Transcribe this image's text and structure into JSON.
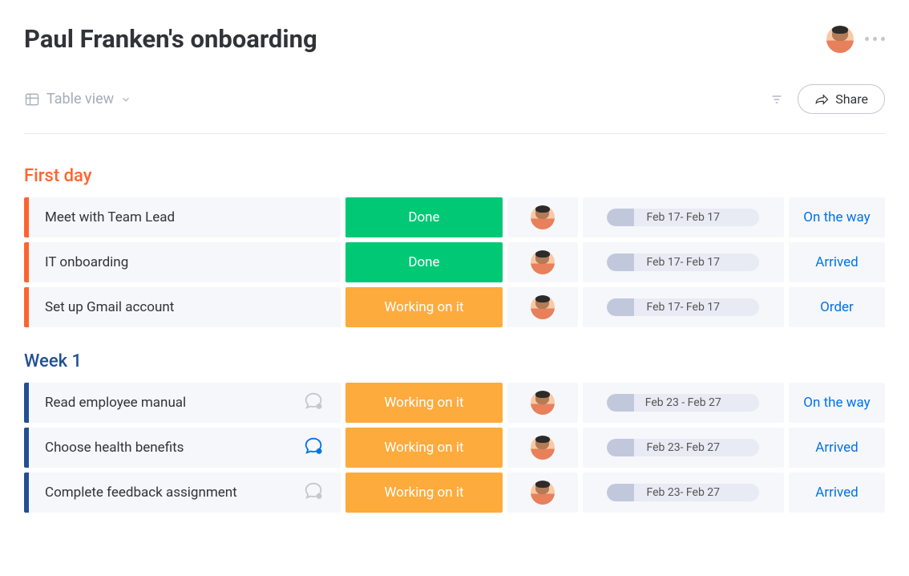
{
  "header": {
    "title": "Paul Franken's onboarding"
  },
  "toolbar": {
    "view_label": "Table view",
    "share_label": "Share"
  },
  "groups": [
    {
      "id": "first-day",
      "title": "First day",
      "color": "orange",
      "rows": [
        {
          "task": "Meet with Team Lead",
          "chat": "none",
          "status": "Done",
          "status_class": "done",
          "date": "Feb 17- Feb 17",
          "fill": 18,
          "action": "On the way"
        },
        {
          "task": "IT onboarding",
          "chat": "none",
          "status": "Done",
          "status_class": "done",
          "date": "Feb 17- Feb 17",
          "fill": 18,
          "action": "Arrived"
        },
        {
          "task": "Set up Gmail account",
          "chat": "none",
          "status": "Working on it",
          "status_class": "working",
          "date": "Feb 17- Feb 17",
          "fill": 18,
          "action": "Order"
        }
      ]
    },
    {
      "id": "week-1",
      "title": "Week 1",
      "color": "navy",
      "rows": [
        {
          "task": "Read employee manual",
          "chat": "empty",
          "status": "Working on it",
          "status_class": "working",
          "date": "Feb 23 - Feb 27",
          "fill": 18,
          "action": "On the way"
        },
        {
          "task": "Choose health benefits",
          "chat": "active",
          "status": "Working on it",
          "status_class": "working",
          "date": "Feb 23- Feb 27",
          "fill": 18,
          "action": "Arrived"
        },
        {
          "task": "Complete feedback assignment",
          "chat": "empty",
          "status": "Working on it",
          "status_class": "working",
          "date": "Feb 23- Feb 27",
          "fill": 18,
          "action": "Arrived"
        }
      ]
    }
  ]
}
